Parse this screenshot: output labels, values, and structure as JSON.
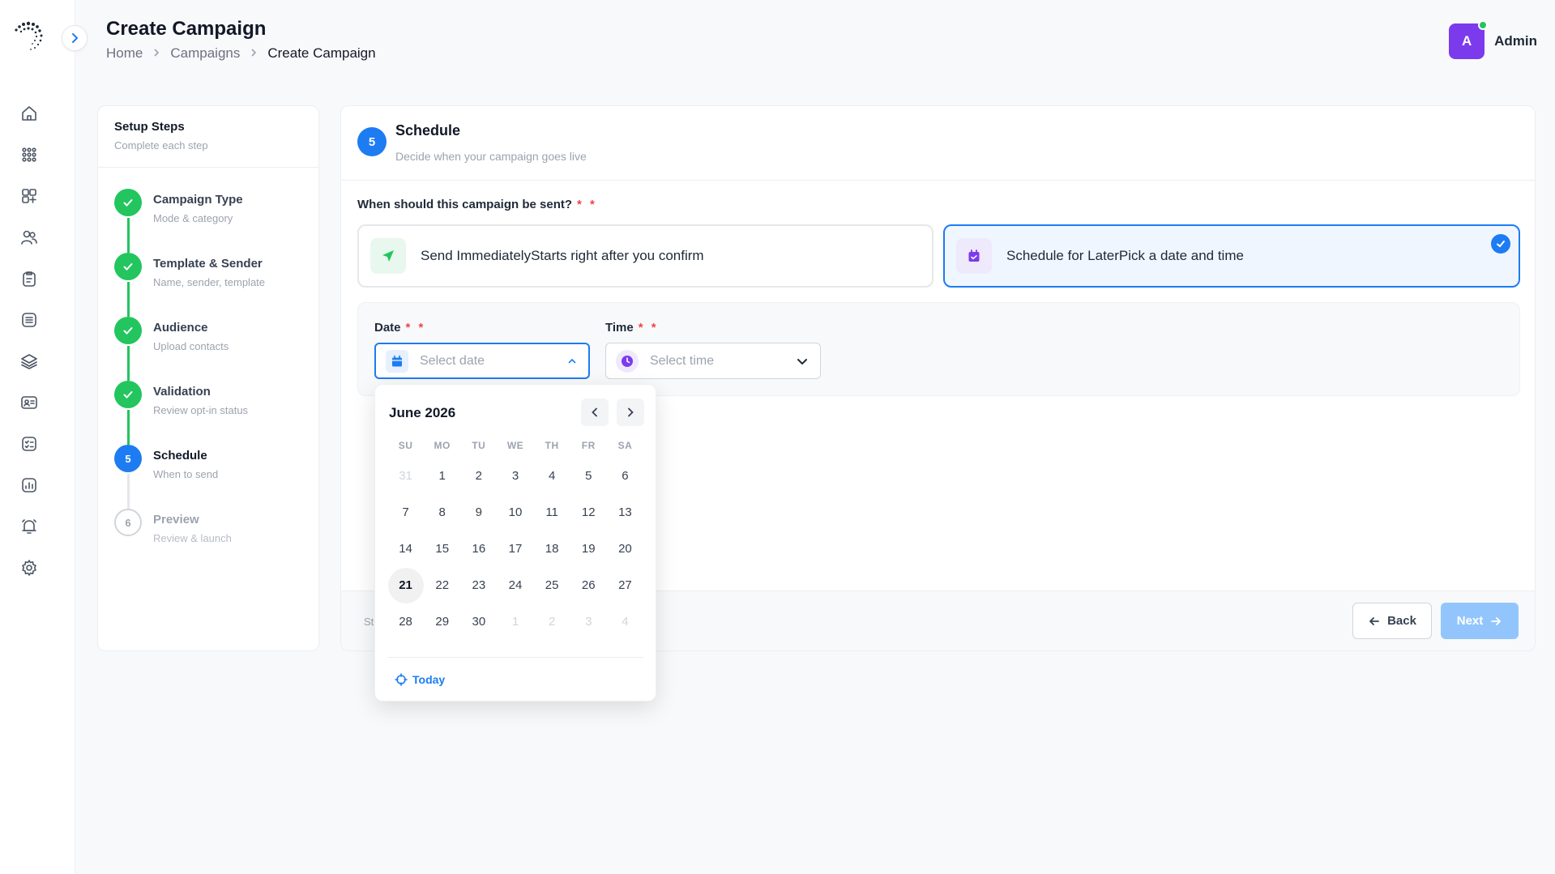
{
  "header": {
    "title": "Create Campaign",
    "breadcrumb": [
      "Home",
      "Campaigns",
      "Create Campaign"
    ],
    "user": {
      "initial": "A",
      "name": "Admin",
      "avatar_color": "#7c3aed",
      "online": true
    }
  },
  "rail": {
    "icons": [
      "home-icon",
      "apps-grid-icon",
      "widgets-add-icon",
      "users-icon",
      "clipboard-icon",
      "list-icon",
      "layers-icon",
      "contact-card-icon",
      "checklist-icon",
      "analytics-icon",
      "alarm-bell-icon",
      "settings-gear-icon"
    ]
  },
  "steps": {
    "title": "Setup Steps",
    "subtitle": "Complete each step",
    "items": [
      {
        "title": "Campaign Type",
        "sub": "Mode & category",
        "status": "done"
      },
      {
        "title": "Template & Sender",
        "sub": "Name, sender, template",
        "status": "done"
      },
      {
        "title": "Audience",
        "sub": "Upload contacts",
        "status": "done"
      },
      {
        "title": "Validation",
        "sub": "Review opt-in status",
        "status": "done"
      },
      {
        "number": "5",
        "title": "Schedule",
        "sub": "When to send",
        "status": "active"
      },
      {
        "number": "6",
        "title": "Preview",
        "sub": "Review & launch",
        "status": "todo"
      }
    ]
  },
  "main": {
    "step_number": "5",
    "title": "Schedule",
    "subtitle": "Decide when your campaign goes live",
    "question": "When should this campaign be sent?",
    "required_marker": "* *",
    "options": {
      "now": {
        "label": "Send ImmediatelyStarts right after you confirm",
        "selected": false
      },
      "later": {
        "label": "Schedule for LaterPick a date and time",
        "selected": true
      }
    },
    "date": {
      "label": "Date",
      "placeholder": "Select date"
    },
    "time": {
      "label": "Time",
      "placeholder": "Select time"
    },
    "footer": {
      "text": "St",
      "back": "Back",
      "next": "Next"
    }
  },
  "calendar": {
    "month": "June 2026",
    "dows": [
      "SU",
      "MO",
      "TU",
      "WE",
      "TH",
      "FR",
      "SA"
    ],
    "days": [
      {
        "d": "31",
        "muted": true
      },
      {
        "d": "1"
      },
      {
        "d": "2"
      },
      {
        "d": "3"
      },
      {
        "d": "4"
      },
      {
        "d": "5"
      },
      {
        "d": "6"
      },
      {
        "d": "7"
      },
      {
        "d": "8"
      },
      {
        "d": "9"
      },
      {
        "d": "10"
      },
      {
        "d": "11"
      },
      {
        "d": "12"
      },
      {
        "d": "13"
      },
      {
        "d": "14"
      },
      {
        "d": "15"
      },
      {
        "d": "16"
      },
      {
        "d": "17"
      },
      {
        "d": "18"
      },
      {
        "d": "19"
      },
      {
        "d": "20"
      },
      {
        "d": "21",
        "selected": true
      },
      {
        "d": "22"
      },
      {
        "d": "23"
      },
      {
        "d": "24"
      },
      {
        "d": "25"
      },
      {
        "d": "26"
      },
      {
        "d": "27"
      },
      {
        "d": "28"
      },
      {
        "d": "29"
      },
      {
        "d": "30"
      },
      {
        "d": "1",
        "muted": true
      },
      {
        "d": "2",
        "muted": true
      },
      {
        "d": "3",
        "muted": true
      },
      {
        "d": "4",
        "muted": true
      }
    ],
    "today_label": "Today"
  },
  "colors": {
    "primary": "#1d7cf2",
    "success": "#22c55e",
    "required": "#ef4444",
    "next_disabled": "#93c5fd"
  }
}
